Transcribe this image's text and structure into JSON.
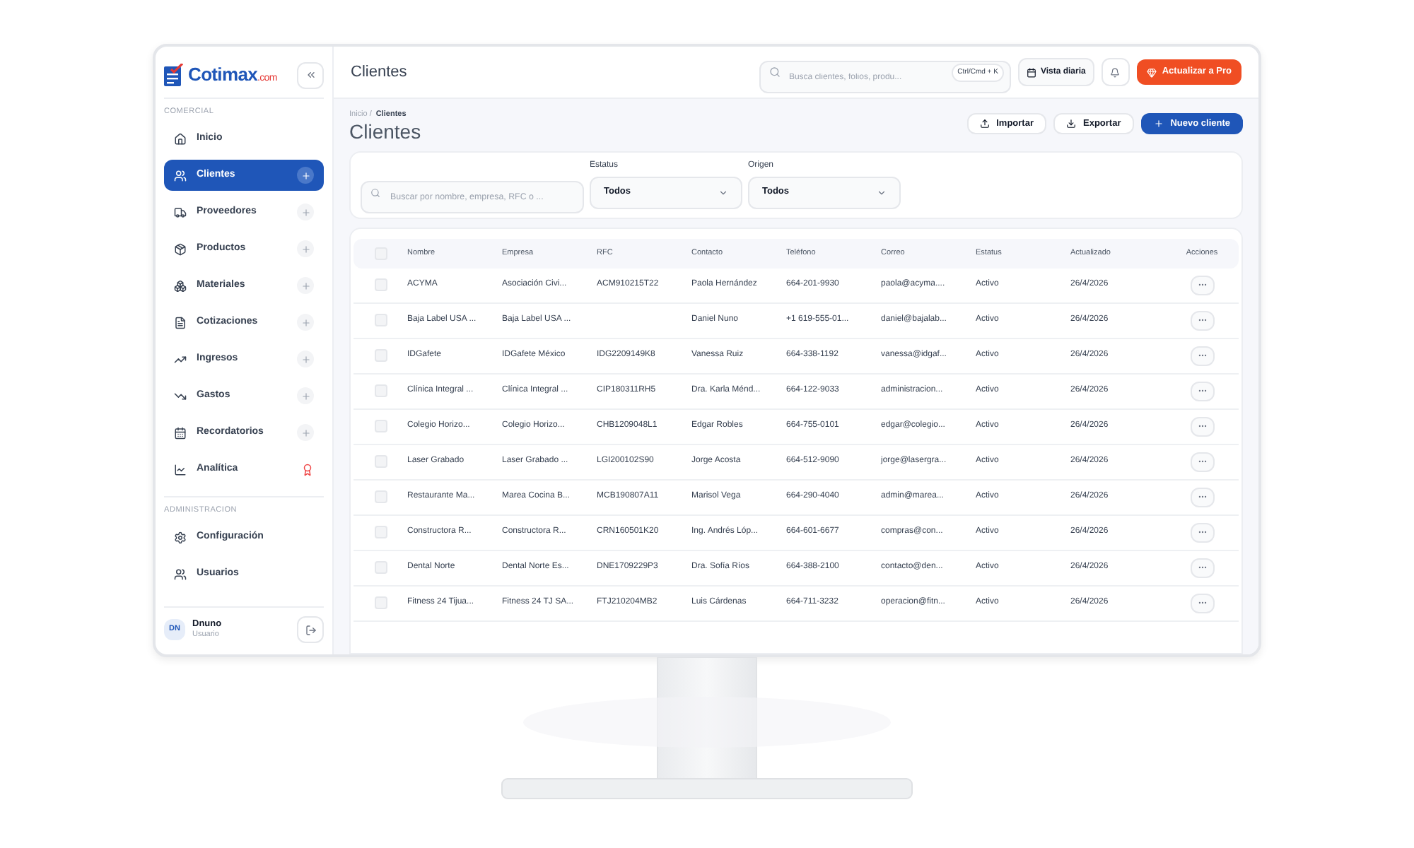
{
  "sidebar": {
    "logo": {
      "name": "Cotimax",
      "suffix": ".com"
    },
    "sections": [
      {
        "title": "COMERCIAL",
        "items": [
          {
            "label": "Inicio",
            "kind": "plain",
            "selected": false
          },
          {
            "label": "Clientes",
            "kind": "add",
            "selected": true
          },
          {
            "label": "Proveedores",
            "kind": "add",
            "selected": false
          },
          {
            "label": "Productos",
            "kind": "add",
            "selected": false
          },
          {
            "label": "Materiales",
            "kind": "add",
            "selected": false
          },
          {
            "label": "Cotizaciones",
            "kind": "add",
            "selected": false
          },
          {
            "label": "Ingresos",
            "kind": "add",
            "selected": false
          },
          {
            "label": "Gastos",
            "kind": "add",
            "selected": false
          },
          {
            "label": "Recordatorios",
            "kind": "add",
            "selected": false
          },
          {
            "label": "Analítica",
            "kind": "pro",
            "selected": false
          }
        ]
      },
      {
        "title": "ADMINISTRACION",
        "items": [
          {
            "label": "Configuración",
            "kind": "plain",
            "selected": false
          },
          {
            "label": "Usuarios",
            "kind": "plain",
            "selected": false
          }
        ]
      }
    ],
    "user": {
      "initials": "DN",
      "name": "Dnuno",
      "role": "Usuario"
    }
  },
  "topbar": {
    "title": "Clientes",
    "search_placeholder": "Busca clientes, folios, produ...",
    "shortcut": "Ctrl/Cmd + K",
    "daily_view": "Vista diaria",
    "upgrade": "Actualizar a Pro"
  },
  "breadcrumb": [
    "Inicio /",
    "Clientes"
  ],
  "page_title": "Clientes",
  "actions": [
    "Importar",
    "Exportar",
    "Nuevo cliente"
  ],
  "filters": {
    "search_placeholder": "Buscar por nombre, empresa, RFC o ...",
    "selects": [
      {
        "label": "Estatus",
        "value": "Todos"
      },
      {
        "label": "Origen",
        "value": "Todos"
      }
    ]
  },
  "table": {
    "columns": [
      "Nombre",
      "Empresa",
      "RFC",
      "Contacto",
      "Teléfono",
      "Correo",
      "Estatus",
      "Actualizado",
      "Acciones"
    ],
    "header_checked": false,
    "rows": [
      {
        "checked": false,
        "cells": [
          "ACYMA",
          "Asociación Civi...",
          "ACM910215T22",
          "Paola Hernández",
          "664-201-9930",
          "paola@acyma....",
          "Activo",
          "26/4/2026"
        ]
      },
      {
        "checked": false,
        "cells": [
          "Baja Label USA ...",
          "Baja Label USA ...",
          "",
          "Daniel Nuno",
          "+1 619-555-01...",
          "daniel@bajalab...",
          "Activo",
          "26/4/2026"
        ]
      },
      {
        "checked": false,
        "cells": [
          "IDGafete",
          "IDGafete México",
          "IDG2209149K8",
          "Vanessa Ruiz",
          "664-338-1192",
          "vanessa@idgaf...",
          "Activo",
          "26/4/2026"
        ]
      },
      {
        "checked": false,
        "cells": [
          "Clínica Integral ...",
          "Clínica Integral ...",
          "CIP180311RH5",
          "Dra. Karla Ménd...",
          "664-122-9033",
          "administracion...",
          "Activo",
          "26/4/2026"
        ]
      },
      {
        "checked": false,
        "cells": [
          "Colegio Horizo...",
          "Colegio Horizo...",
          "CHB1209048L1",
          "Edgar Robles",
          "664-755-0101",
          "edgar@colegio...",
          "Activo",
          "26/4/2026"
        ]
      },
      {
        "checked": false,
        "cells": [
          "Laser Grabado",
          "Laser Grabado ...",
          "LGI200102S90",
          "Jorge Acosta",
          "664-512-9090",
          "jorge@lasergra...",
          "Activo",
          "26/4/2026"
        ]
      },
      {
        "checked": false,
        "cells": [
          "Restaurante Ma...",
          "Marea Cocina B...",
          "MCB190807A11",
          "Marisol Vega",
          "664-290-4040",
          "admin@marea...",
          "Activo",
          "26/4/2026"
        ]
      },
      {
        "checked": false,
        "cells": [
          "Constructora R...",
          "Constructora R...",
          "CRN160501K20",
          "Ing. Andrés Lóp...",
          "664-601-6677",
          "compras@con...",
          "Activo",
          "26/4/2026"
        ]
      },
      {
        "checked": false,
        "cells": [
          "Dental Norte",
          "Dental Norte Es...",
          "DNE1709229P3",
          "Dra. Sofía Ríos",
          "664-388-2100",
          "contacto@den...",
          "Activo",
          "26/4/2026"
        ]
      },
      {
        "checked": false,
        "cells": [
          "Fitness 24 Tijua...",
          "Fitness 24 TJ SA...",
          "FTJ210204MB2",
          "Luis Cárdenas",
          "664-711-3232",
          "operacion@fitn...",
          "Activo",
          "26/4/2026"
        ]
      }
    ]
  }
}
